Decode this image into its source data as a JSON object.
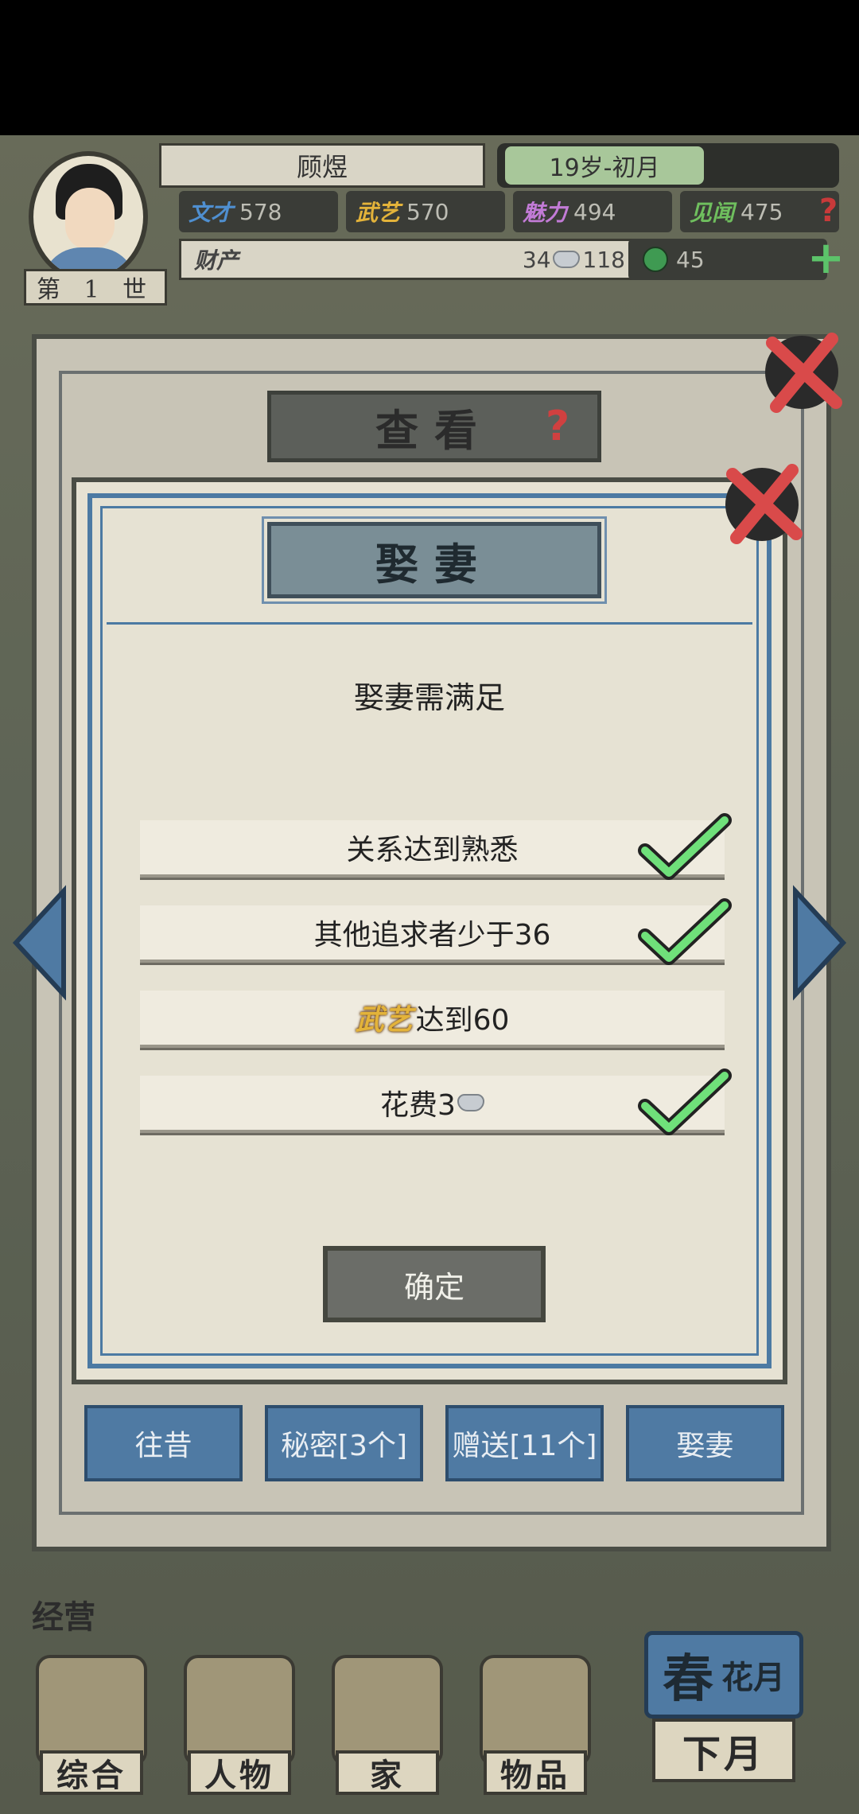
{
  "header": {
    "name": "顾煜",
    "age": "19岁-初月",
    "generation": "第 1 世",
    "stats": [
      {
        "label": "文才",
        "value": "578",
        "color": "#4f8fd0"
      },
      {
        "label": "武艺",
        "value": "570",
        "color": "#e3b33a"
      },
      {
        "label": "魅力",
        "value": "494",
        "color": "#c27bd6"
      },
      {
        "label": "见闻",
        "value": "475",
        "color": "#6fbf5e"
      }
    ],
    "wealth_label": "财产",
    "silver": "34",
    "coins": "118",
    "gems": "45"
  },
  "look_panel": {
    "title": "查看",
    "tabs": [
      "往昔",
      "秘密[3个]",
      "赠送[11个]",
      "娶妻"
    ]
  },
  "dialog": {
    "title": "娶妻",
    "subtitle": "娶妻需满足",
    "requirements": [
      {
        "text": "关系达到熟悉",
        "met": true
      },
      {
        "text": "其他追求者少于36",
        "met": true
      },
      {
        "highlight": "武艺",
        "text": "达到60",
        "met": false
      },
      {
        "text": "花费3",
        "met": true
      }
    ],
    "confirm_label": "确定"
  },
  "bottom_nav": {
    "section_label": "经营",
    "items": [
      "综合",
      "人物",
      "家",
      "物品"
    ],
    "season": {
      "big": "春",
      "small": "花月",
      "button": "下月"
    }
  }
}
